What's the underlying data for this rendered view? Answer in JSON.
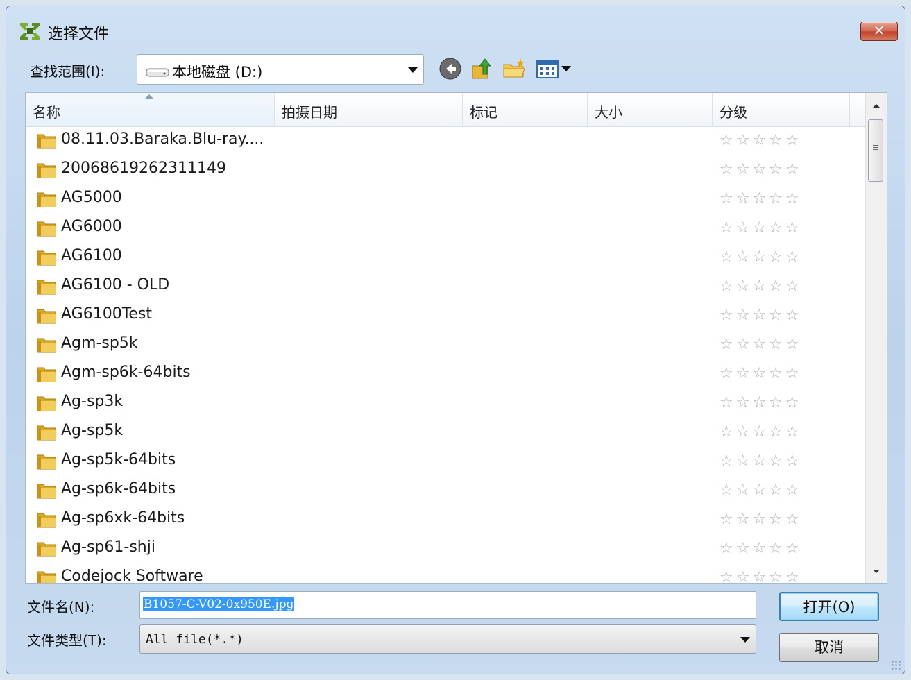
{
  "window": {
    "title": "选择文件",
    "close_label": "✕"
  },
  "lookin": {
    "label": "查找范围(I):",
    "value": "本地磁盘 (D:)"
  },
  "columns": [
    {
      "label": "名称"
    },
    {
      "label": "拍摄日期"
    },
    {
      "label": "标记"
    },
    {
      "label": "大小"
    },
    {
      "label": "分级"
    }
  ],
  "files": [
    {
      "name": "08.11.03.Baraka.Blu-ray...."
    },
    {
      "name": "20068619262311149"
    },
    {
      "name": "AG5000"
    },
    {
      "name": "AG6000"
    },
    {
      "name": "AG6100"
    },
    {
      "name": "AG6100 - OLD"
    },
    {
      "name": "AG6100Test"
    },
    {
      "name": "Agm-sp5k"
    },
    {
      "name": "Agm-sp6k-64bits"
    },
    {
      "name": "Ag-sp3k"
    },
    {
      "name": "Ag-sp5k"
    },
    {
      "name": "Ag-sp5k-64bits"
    },
    {
      "name": "Ag-sp6k-64bits"
    },
    {
      "name": "Ag-sp6xk-64bits"
    },
    {
      "name": "Ag-sp61-shji"
    },
    {
      "name": "Codejock Software"
    }
  ],
  "rating_stars": "☆☆☆☆☆",
  "filename": {
    "label": "文件名(N):",
    "value": "B1057-C-V02-0x950E.jpg"
  },
  "filetype": {
    "label": "文件类型(T):",
    "value": "All file(*.*)"
  },
  "buttons": {
    "open": "打开(O)",
    "cancel": "取消"
  }
}
